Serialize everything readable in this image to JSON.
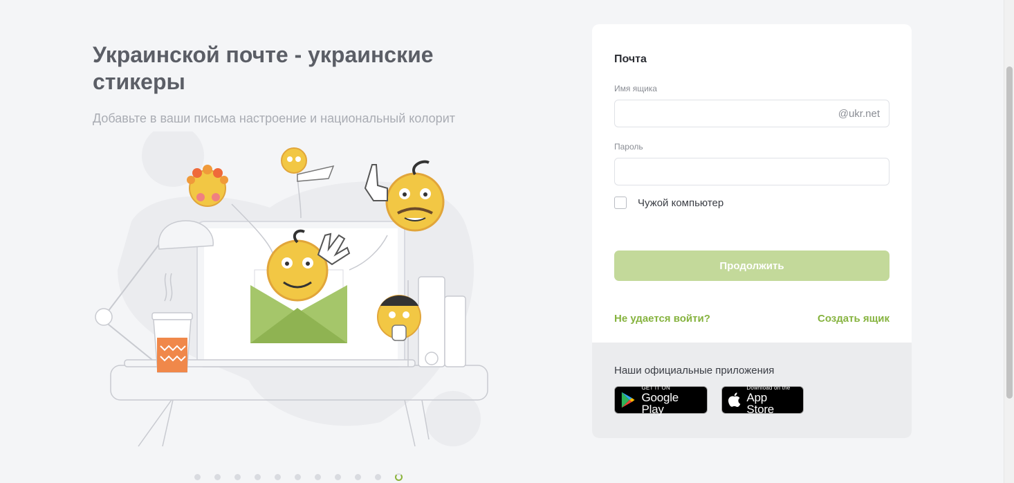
{
  "promo": {
    "title": "Украинской почте - украинские стикеры",
    "subtitle": "Добавьте в ваши письма настроение и национальный колорит"
  },
  "carousel": {
    "total": 11,
    "active_index": 11
  },
  "login": {
    "title": "Почта",
    "username_label": "Имя ящика",
    "username_value": "",
    "username_suffix": "@ukr.net",
    "password_label": "Пароль",
    "password_value": "",
    "foreign_computer_label": "Чужой компьютер",
    "foreign_computer_checked": false,
    "continue_label": "Продолжить",
    "cant_login_link": "Не удается войти?",
    "create_box_link": "Создать ящик"
  },
  "apps": {
    "title": "Наши официальные приложения",
    "google_play": {
      "small": "GET IT ON",
      "big": "Google Play"
    },
    "app_store": {
      "small": "Download on the",
      "big": "App Store"
    }
  },
  "colors": {
    "accent": "#86b33f",
    "button_disabled": "#c3d99a",
    "background": "#f4f5f7",
    "title_text": "#5b5e66"
  }
}
